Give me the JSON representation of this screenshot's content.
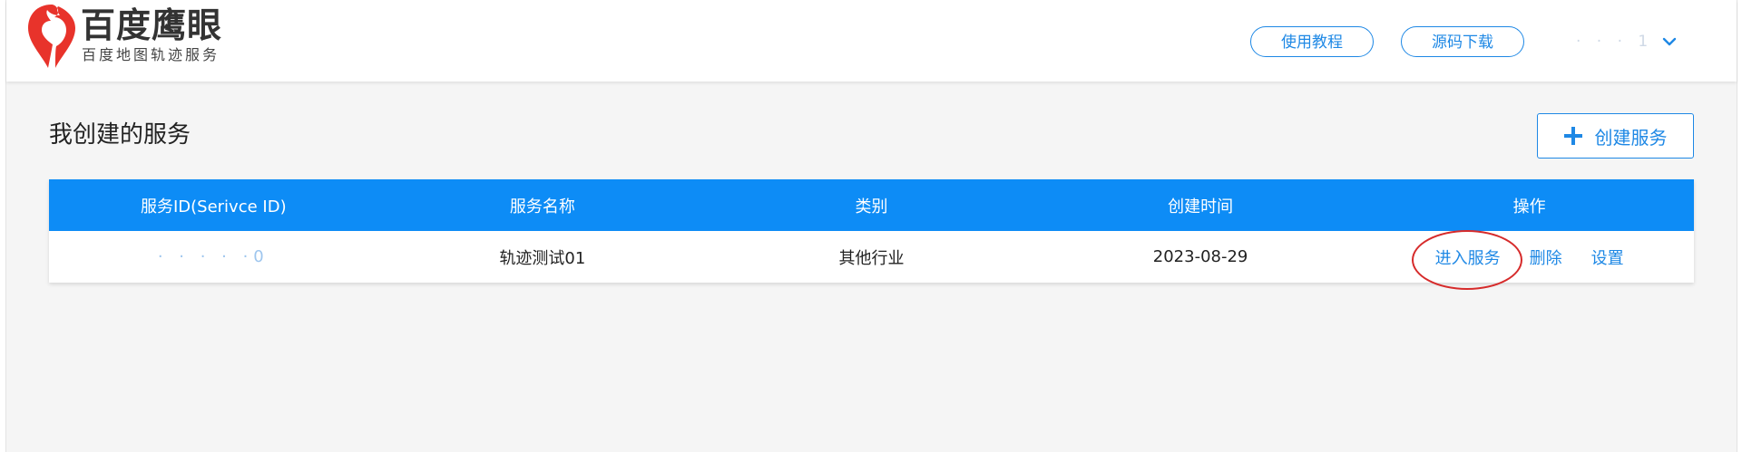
{
  "logo": {
    "title": "百度鹰眼",
    "subtitle": "百度地图轨迹服务"
  },
  "header": {
    "tutorial_label": "使用教程",
    "download_label": "源码下载",
    "user_name": "· · · 1"
  },
  "page": {
    "title": "我创建的服务",
    "create_label": "创建服务"
  },
  "table": {
    "headers": [
      "服务ID(Serivce ID)",
      "服务名称",
      "类别",
      "创建时间",
      "操作"
    ],
    "rows": [
      {
        "service_id": "· · · · ·0",
        "name": "轨迹测试01",
        "category": "其他行业",
        "created": "2023-08-29",
        "actions": [
          "进入服务",
          "删除",
          "设置"
        ]
      }
    ]
  },
  "colors": {
    "accent": "#1e88e5",
    "table_header_bg": "#0d8cf6",
    "logo_red": "#e8332b",
    "highlight_red": "#d62b2b"
  },
  "icons": {
    "logo": "eagle-logo-icon",
    "user_menu": "chevron-down-icon",
    "create": "plus-icon"
  }
}
